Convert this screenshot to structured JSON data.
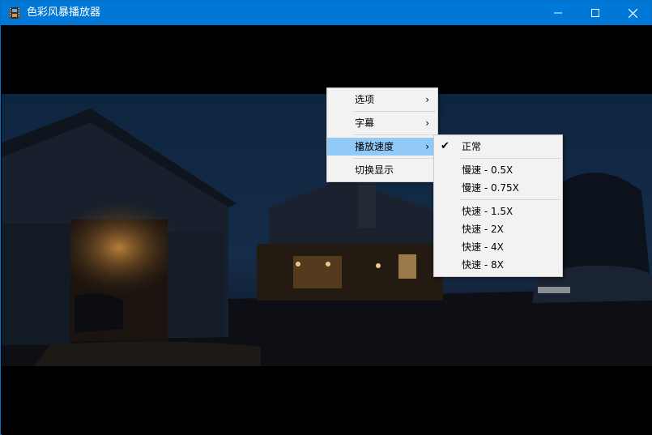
{
  "window": {
    "title": "色彩风暴播放器"
  },
  "context_menu": {
    "items": [
      {
        "label": "选项"
      },
      {
        "label": "字幕"
      },
      {
        "label": "播放速度"
      },
      {
        "label": "切换显示"
      }
    ]
  },
  "speed_menu": {
    "normal": "正常",
    "slow_05": "慢速 - 0.5X",
    "slow_075": "慢速 - 0.75X",
    "fast_15": "快速 - 1.5X",
    "fast_2": "快速 - 2X",
    "fast_4": "快速 - 4X",
    "fast_8": "快速 - 8X",
    "selected": "正常"
  },
  "colors": {
    "titlebar": "#0078d7",
    "menu_highlight": "#91c9f7",
    "menu_bg": "#f2f2f2"
  }
}
